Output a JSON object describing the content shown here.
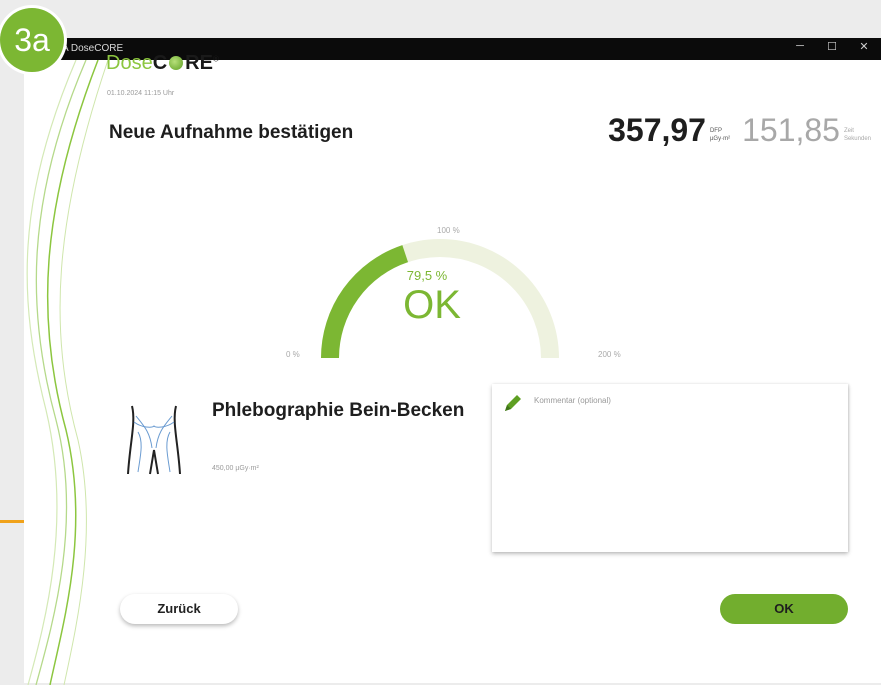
{
  "badge": "3a",
  "window": {
    "title": "A DoseCORE",
    "controls": {
      "minimize": "─",
      "maximize": "☐",
      "close": "✕"
    }
  },
  "logo": {
    "dose": "Dose",
    "core_c": "C",
    "core_re": "RE",
    "reg": "®"
  },
  "datetime": "01.10.2024 11:15 Uhr",
  "heading": "Neue Aufnahme bestätigen",
  "dose": {
    "value": "357,97",
    "unit_top": "DFP",
    "unit_bottom": "µGy·m²",
    "seconds": "151,85",
    "seconds_unit_top": "Zeit",
    "seconds_unit_bottom": "Sekunden"
  },
  "gauge": {
    "label_min": "0 %",
    "label_mid": "100 %",
    "label_max": "200 %",
    "percent_text": "79,5 %",
    "status": "OK",
    "value_percent": 79.5,
    "max_percent": 200,
    "fill_color": "#7cb733",
    "track_color": "#eef2df"
  },
  "exam": {
    "name": "Phlebographie Bein-Becken",
    "reference": "450,00 µGy·m²",
    "icon": "pelvis-legs-icon"
  },
  "comment": {
    "placeholder": "Kommentar (optional)",
    "icon": "pencil-icon"
  },
  "buttons": {
    "back": "Zurück",
    "ok": "OK"
  },
  "colors": {
    "accent": "#7cb733",
    "badge": "#7cb733",
    "orange": "#f0a21a"
  }
}
